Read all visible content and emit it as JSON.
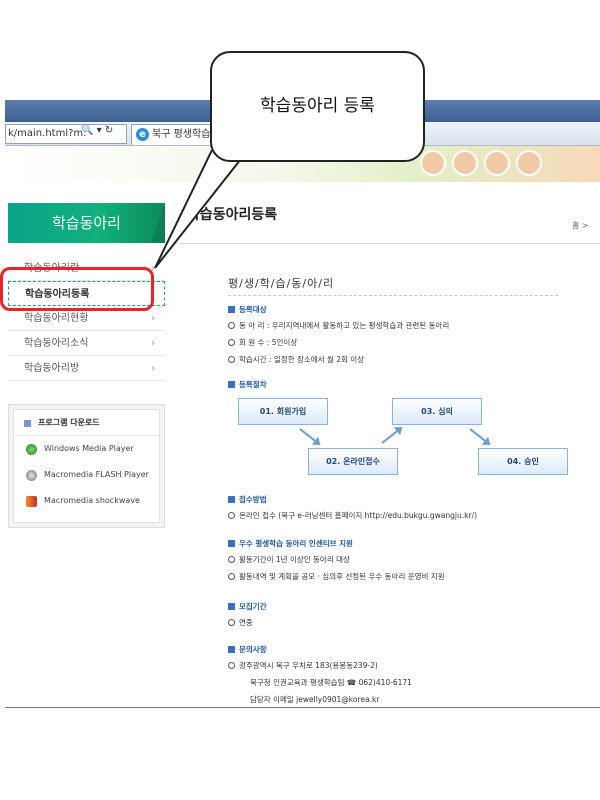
{
  "callout": {
    "text": "학습동아리 등록"
  },
  "browser": {
    "url": "k/main.html?m: 🔍 ▾ ↻",
    "url_text": "k/main.html?m:",
    "tab_title": "북구 평생학습"
  },
  "sidebar": {
    "title": "학습동아리",
    "items": [
      {
        "label": "학습동아리란",
        "active": false
      },
      {
        "label": "학습동아리등록",
        "active": true
      },
      {
        "label": "학습동아리현황",
        "active": false
      },
      {
        "label": "학습동아리소식",
        "active": false
      },
      {
        "label": "학습동아리방",
        "active": false
      }
    ],
    "download": {
      "title": "프로그램 다운로드",
      "items": [
        {
          "label": "Windows Media Player",
          "icon": "windows-media-icon"
        },
        {
          "label": "Macromedia FLASH Player",
          "icon": "flash-player-icon"
        },
        {
          "label": "Macromedia shockwave",
          "icon": "shockwave-icon"
        }
      ]
    }
  },
  "main": {
    "page_title": "학습동아리등록",
    "home_link": "홈 >",
    "sub_title": "평/생/학/습/동/아/리",
    "sections": {
      "target": {
        "heading": "등록대상",
        "lines": [
          "동 아 리 : 우리지역내에서 활동하고 있는 평생학습과 관련된 동아리",
          "회 원 수 : 5인이상",
          "학습시간 : 일정한 장소에서 월 2회 이상"
        ]
      },
      "procedure": {
        "heading": "등록절차",
        "steps": [
          "01. 회원가입",
          "02. 온라인접수",
          "03. 심의",
          "04. 승인"
        ]
      },
      "method": {
        "heading": "접수방법",
        "lines": [
          "온라인 접수 (북구 e-러닝센터 홈페이지 http://edu.bukgu.gwangju.kr/)"
        ]
      },
      "incentive": {
        "heading": "우수 평생학습 동아리 인센티브 지원",
        "lines": [
          "활동기간이 1년 이상인 동아리 대상",
          "활동내역 및 계획을 공모 · 심의후 선정된 우수 동아리 운영비 지원"
        ]
      },
      "period": {
        "heading": "모집기간",
        "lines": [
          "연중"
        ]
      },
      "contact": {
        "heading": "문의사항",
        "lines": [
          "광주광역시 북구 우치로 183(용봉동239-2)"
        ],
        "plain_lines": [
          "북구청 인권교육과 평생학습팀 ☎ 062)410-6171",
          "담당자 이메일 jewelly0901@korea.kr"
        ]
      }
    }
  },
  "colors": {
    "accent_green": "#0aa58b",
    "highlight_red": "#e8232b",
    "section_blue": "#1d5aa6"
  }
}
